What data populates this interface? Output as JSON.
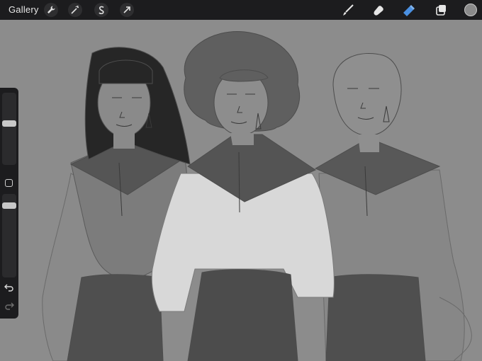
{
  "topbar": {
    "gallery_label": "Gallery",
    "left_tools": [
      "wrench-icon",
      "magic-wand-icon",
      "selection-icon",
      "transform-arrow-icon"
    ],
    "right_tools": [
      "brush-icon",
      "smudge-icon",
      "eraser-icon",
      "layers-icon"
    ],
    "active_tool": "eraser-icon",
    "active_color": "#4a90e2",
    "current_color": "#8a8a8a"
  },
  "sidebar": {
    "brush_size_level": 0.85,
    "opacity_level": 0.82,
    "buttons": [
      "modify-square-icon",
      "undo-icon",
      "redo-icon"
    ]
  },
  "canvas": {
    "background_color": "#8c8c8c",
    "artwork": "three-figures-sketch"
  }
}
